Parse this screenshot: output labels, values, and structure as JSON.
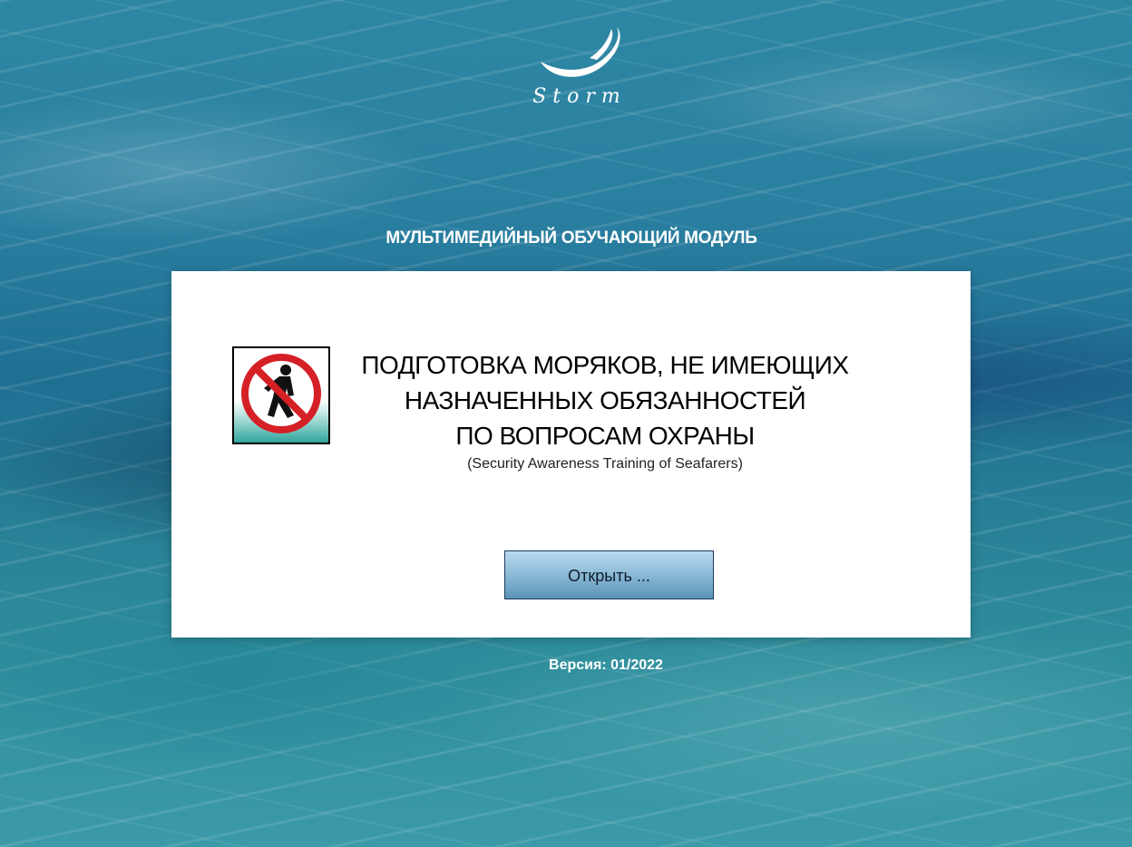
{
  "logo": {
    "text": "Storm",
    "icon": "swan-icon"
  },
  "header": {
    "module_title": "МУЛЬТИМЕДИЙНЫЙ ОБУЧАЮЩИЙ МОДУЛЬ"
  },
  "card": {
    "sign_icon": "no-pedestrian-sign-icon",
    "title_lines": [
      "ПОДГОТОВКА МОРЯКОВ, НЕ ИМЕЮЩИХ",
      "НАЗНАЧЕННЫХ ОБЯЗАННОСТЕЙ",
      "ПО ВОПРОСАМ ОХРАНЫ"
    ],
    "subtitle": "(Security Awareness Training of Seafarers)",
    "open_button_label": "Открыть ..."
  },
  "footer": {
    "version": "Версия: 01/2022"
  },
  "colors": {
    "background": "#2a7fa0",
    "card": "#ffffff",
    "sign_red": "#d42026",
    "sign_teal": "#3fb0a8",
    "button_top": "#b9d9ee",
    "button_bottom": "#5d93b8"
  }
}
